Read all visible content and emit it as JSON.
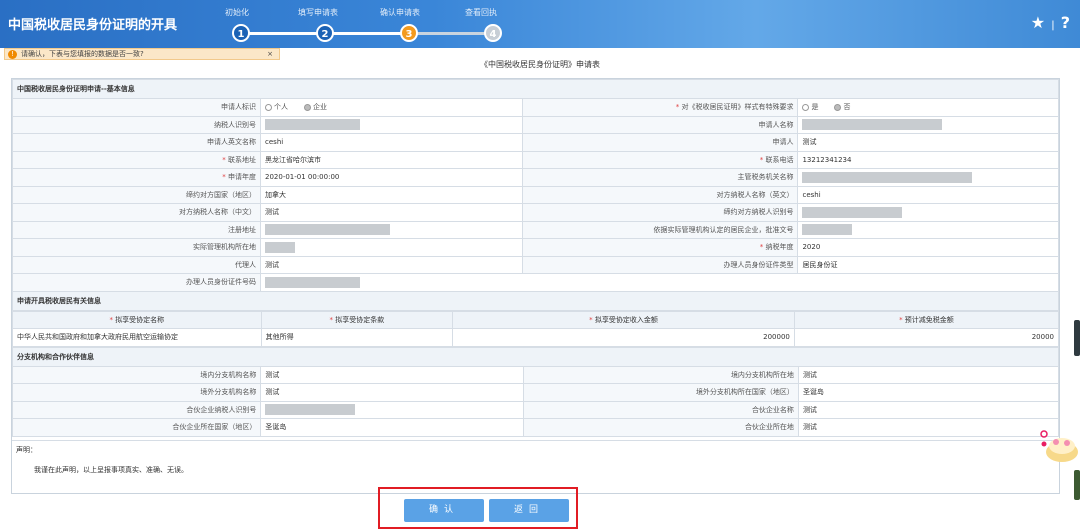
{
  "header": {
    "title": "中国税收居民身份证明的开具",
    "steps": [
      {
        "num": "1",
        "label": "初始化"
      },
      {
        "num": "2",
        "label": "填写申请表"
      },
      {
        "num": "3",
        "label": "确认申请表"
      },
      {
        "num": "4",
        "label": "查看回执"
      }
    ],
    "star": "★",
    "help": "?"
  },
  "notice": {
    "text": "请确认，下表与您填报的数据是否一致?",
    "close": "×"
  },
  "form_title": "《中国税收居民身份证明》申请表",
  "sec1": "中国税收居民身份证明申请--基本信息",
  "rows": {
    "r1": {
      "l1": "申请人标识",
      "opt1": "个人",
      "opt2": "企业",
      "l2": "对《税收居民证明》样式有特殊要求",
      "opt3": "是",
      "opt4": "否"
    },
    "r2": {
      "l1": "纳税人识别号",
      "l2": "申请人名称"
    },
    "r3": {
      "l1": "申请人英文名称",
      "v1": "ceshi",
      "l2": "申请人",
      "v2": "测试"
    },
    "r4": {
      "l1": "联系地址",
      "v1": "黑龙江省哈尔滨市",
      "l2": "联系电话",
      "v2": "13212341234"
    },
    "r5": {
      "l1": "申请年度",
      "v1": "2020-01-01  00:00:00",
      "l2": "主管税务机关名称"
    },
    "r6": {
      "l1": "缔约对方国家（地区）",
      "v1": "加拿大",
      "l2": "对方纳税人名称（英文）",
      "v2": "ceshi"
    },
    "r7": {
      "l1": "对方纳税人名称（中文）",
      "v1": "测试",
      "l2": "缔约对方纳税人识别号"
    },
    "r8": {
      "l1": "注册地址",
      "l2": "依据实际管理机构认定的居民企业，批准文号"
    },
    "r9": {
      "l1": "实际管理机构所在地",
      "l2": "纳税年度",
      "v2": "2020"
    },
    "r10": {
      "l1": "代理人",
      "v1": "测试",
      "l2": "办理人员身份证件类型",
      "v2": "居民身份证"
    },
    "r11": {
      "l1": "办理人员身份证件号码"
    }
  },
  "sec2": "申请开具税收居民有关信息",
  "treaty": {
    "h1": "拟享受协定名称",
    "h2": "拟享受协定条款",
    "h3": "拟享受协定收入金额",
    "h4": "预计减免税金额",
    "v1": "中华人民共和国政府和加拿大政府民用航空运输协定",
    "v2": "其他所得",
    "v3": "200000",
    "v4": "20000"
  },
  "sec3": "分支机构和合作伙伴信息",
  "branch": {
    "b1": {
      "l1": "境内分支机构名称",
      "v1": "测试",
      "l2": "境内分支机构所在地",
      "v2": "测试"
    },
    "b2": {
      "l1": "境外分支机构名称",
      "v1": "测试",
      "l2": "境外分支机构所在国家（地区）",
      "v2": "圣诞岛"
    },
    "b3": {
      "l1": "合伙企业纳税人识别号",
      "l2": "合伙企业名称",
      "v2": "测试"
    },
    "b4": {
      "l1": "合伙企业所在国家（地区）",
      "v1": "圣诞岛",
      "l2": "合伙企业所在地",
      "v2": "测试"
    }
  },
  "declaration": {
    "title": "声明：",
    "text": "我谨在此声明，以上呈报事项真实、准确、无误。"
  },
  "buttons": {
    "confirm": "确认",
    "back": "返回"
  },
  "colors": {
    "header": "#3a86d8",
    "accent": "#f39a1e",
    "button": "#5aa2e6",
    "highlight": "#e11c24"
  }
}
